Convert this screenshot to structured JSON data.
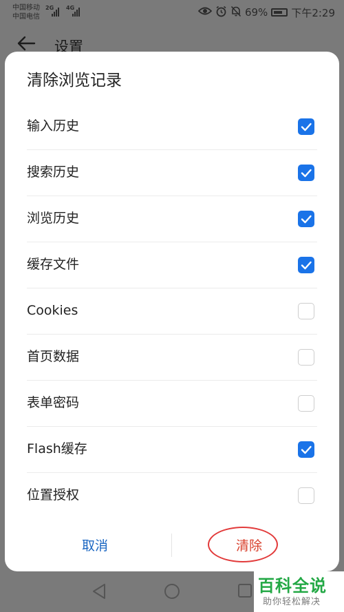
{
  "status_bar": {
    "carrier_1": "中国移动",
    "carrier_2": "中国电信",
    "net_1": "2G",
    "net_2": "4G",
    "battery_percent": "69%",
    "time": "下午2:29",
    "icons": [
      "eye-icon",
      "alarm-icon",
      "mute-icon",
      "battery-icon"
    ]
  },
  "background_page": {
    "title": "设置"
  },
  "dialog": {
    "title": "清除浏览记录",
    "options": [
      {
        "label": "输入历史",
        "checked": true
      },
      {
        "label": "搜索历史",
        "checked": true
      },
      {
        "label": "浏览历史",
        "checked": true
      },
      {
        "label": "缓存文件",
        "checked": true
      },
      {
        "label": "Cookies",
        "checked": false
      },
      {
        "label": "首页数据",
        "checked": false
      },
      {
        "label": "表单密码",
        "checked": false
      },
      {
        "label": "Flash缓存",
        "checked": true
      },
      {
        "label": "位置授权",
        "checked": false
      }
    ],
    "cancel_label": "取消",
    "clear_label": "清除"
  },
  "colors": {
    "accent": "#1a73e8",
    "cancel_text": "#1a66c2",
    "clear_text": "#d9412e",
    "annotation_circle": "#e23a3a",
    "watermark": "#23a845"
  },
  "watermark": {
    "title": "百科全说",
    "subtitle": "助你轻松解决"
  }
}
